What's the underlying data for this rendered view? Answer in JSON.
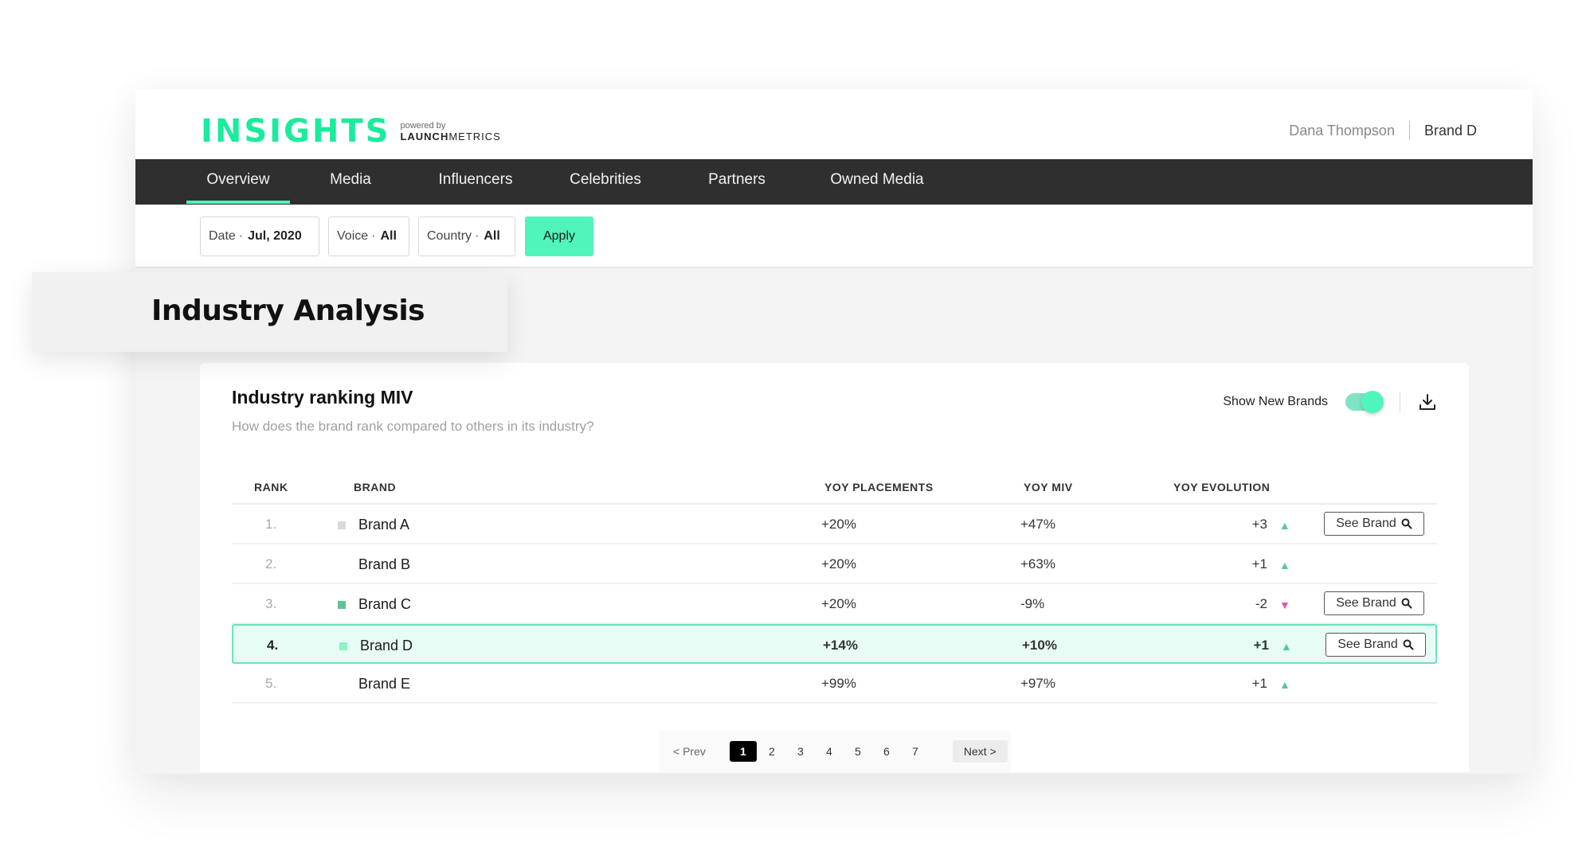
{
  "header": {
    "logo_main": "INSIGHTS",
    "logo_powered": "powered by",
    "logo_launch_bold": "LAUNCH",
    "logo_launch_light": "METRICS",
    "user_name": "Dana Thompson",
    "brand_name": "Brand D"
  },
  "nav": {
    "items": [
      {
        "label": "Overview",
        "active": true
      },
      {
        "label": "Media"
      },
      {
        "label": "Influencers"
      },
      {
        "label": "Celebrities"
      },
      {
        "label": "Partners"
      },
      {
        "label": "Owned Media"
      }
    ]
  },
  "filters": {
    "date": {
      "label": "Date",
      "value": "Jul, 2020"
    },
    "voice": {
      "label": "Voice",
      "value": "All"
    },
    "country": {
      "label": "Country",
      "value": "All"
    },
    "separator": "·",
    "apply_label": "Apply"
  },
  "section": {
    "title": "Industry Analysis"
  },
  "card": {
    "title": "Industry ranking MIV",
    "subtitle": "How does the brand rank compared to others in its industry?",
    "toggle_label": "Show New Brands",
    "toggle_on": true,
    "download_icon": "download-icon"
  },
  "table": {
    "columns": [
      "RANK",
      "BRAND",
      "YOY PLACEMENTS",
      "YOY MIV",
      "YOY EVOLUTION"
    ],
    "see_brand_label": "See Brand",
    "rows": [
      {
        "rank": "1.",
        "brand": "Brand A",
        "color": "#d9d9d9",
        "placements": "+20%",
        "miv": "+47%",
        "evolution": "+3",
        "direction": "up",
        "see_brand": true
      },
      {
        "rank": "2.",
        "brand": "Brand B",
        "color": "",
        "placements": "+20%",
        "miv": "+63%",
        "evolution": "+1",
        "direction": "up",
        "see_brand": false
      },
      {
        "rank": "3.",
        "brand": "Brand C",
        "color": "#5ec496",
        "placements": "+20%",
        "miv": "-9%",
        "evolution": "-2",
        "direction": "down",
        "see_brand": true
      },
      {
        "rank": "4.",
        "brand": "Brand D",
        "color": "#8ff2c4",
        "placements": "+14%",
        "miv": "+10%",
        "evolution": "+1",
        "direction": "up",
        "see_brand": true,
        "highlight": true
      },
      {
        "rank": "5.",
        "brand": "Brand E",
        "color": "",
        "placements": "+99%",
        "miv": "+97%",
        "evolution": "+1",
        "direction": "up",
        "see_brand": false
      }
    ]
  },
  "pagination": {
    "prev_label": "< Prev",
    "next_label": "Next >",
    "pages": [
      "1",
      "2",
      "3",
      "4",
      "5",
      "6",
      "7"
    ],
    "current": "1"
  },
  "colors": {
    "accent": "#4ff5ba",
    "logo": "#19ec9d",
    "nav_bg": "#2f2f2f",
    "up": "#57c796",
    "down": "#e752ab",
    "highlight_bg": "#e6fcf4",
    "highlight_border": "#6fe0bf"
  }
}
